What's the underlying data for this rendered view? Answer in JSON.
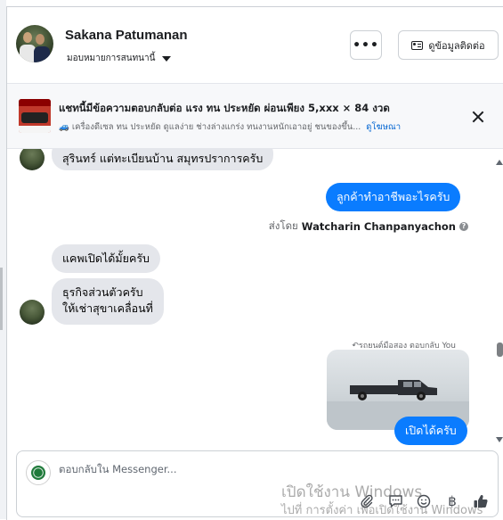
{
  "header": {
    "name": "Sakana Patumanan",
    "assign_label": "มอบหมายการสนทนานี้",
    "more_label": "•••",
    "contact_label": "ดูข้อมูลติดต่อ"
  },
  "ad": {
    "title": "แชทนี้มีข้อความตอบกลับต่อ แรง ทน ประหยัด ผ่อนเพียง 5,xxx × 84 งวด",
    "subtitle": "🚙 เครื่องดีเซล ทน ประหยัด ดูแลง่าย ช่างล่างแกร่ง ทนงานหนักเอาอยู่ ชนของขึ้น...",
    "link": "ดูโฆษณา"
  },
  "messages": [
    {
      "text": "สุรินทร์ แต่ทะเบียนบ้าน สมุทรปราการครับ",
      "direction": "in"
    },
    {
      "text": "ลูกค้าทำอาชีพอะไรครับ",
      "direction": "out"
    },
    {
      "text": "แคพเปิดได้มั้ยครับ",
      "direction": "in"
    },
    {
      "text": "ธุรกิจส่วนตัวครับ\nให้เช่าสุขาเคลื่อนที่",
      "line1": "ธุรกิจส่วนตัวครับ",
      "line2": "ให้เช่าสุขาเคลื่อนที่",
      "direction": "in"
    },
    {
      "text": "เปิดได้ครับ",
      "direction": "out"
    }
  ],
  "sent_by": {
    "prefix": "ส่งโดย",
    "name": "Watcharin Chanpanyachon",
    "help_icon": "?"
  },
  "reply_context": "↶รถยนต์มือสอง ตอบกลับ You",
  "composer": {
    "placeholder": "ตอบกลับใน Messenger..."
  },
  "toolbar_icons": [
    "paperclip-icon",
    "chat-icon",
    "emoji-icon",
    "baht-icon",
    "thumbs-up-icon"
  ],
  "baht_symbol": "฿",
  "watermark": {
    "line1": "เปิดใช้งาน Windows",
    "line2": "ไปที่ การตั้งค่า เพื่อเปิดใช้งาน Windows"
  },
  "colors": {
    "accent": "#0a7cff",
    "incoming_bubble": "#e4e6eb",
    "link": "#0064d1"
  }
}
